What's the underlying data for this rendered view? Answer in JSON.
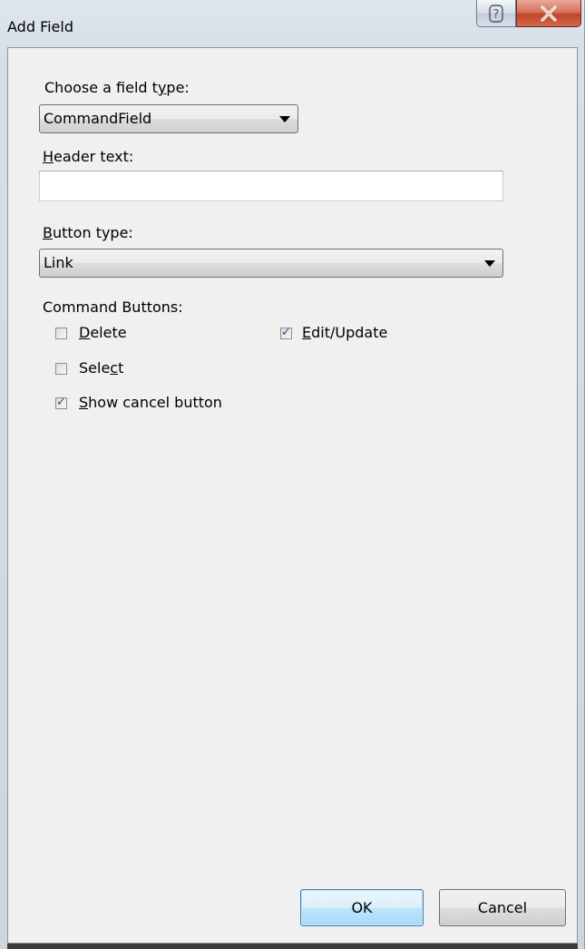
{
  "window": {
    "title": "Add Field",
    "help_glyph": "?",
    "close_glyph": "X"
  },
  "field_type": {
    "label_pre": "Choose a field t",
    "label_accel": "y",
    "label_post": "pe:",
    "selected": "CommandField"
  },
  "header_text": {
    "label_accel": "H",
    "label_post": "eader text:",
    "value": ""
  },
  "button_type": {
    "label_accel": "B",
    "label_post": "utton type:",
    "selected": "Link"
  },
  "command_buttons": {
    "label": "Command Buttons:",
    "delete": {
      "accel": "D",
      "rest": "elete",
      "checked": false
    },
    "edit_update": {
      "accel": "E",
      "rest": "dit/Update",
      "checked": true
    },
    "select": {
      "pre": "Sele",
      "accel": "c",
      "rest": "t",
      "checked": false
    },
    "show_cancel": {
      "accel": "S",
      "rest": "how cancel button",
      "checked": true
    }
  },
  "buttons": {
    "ok": "OK",
    "cancel": "Cancel"
  },
  "check_glyph": "✓"
}
